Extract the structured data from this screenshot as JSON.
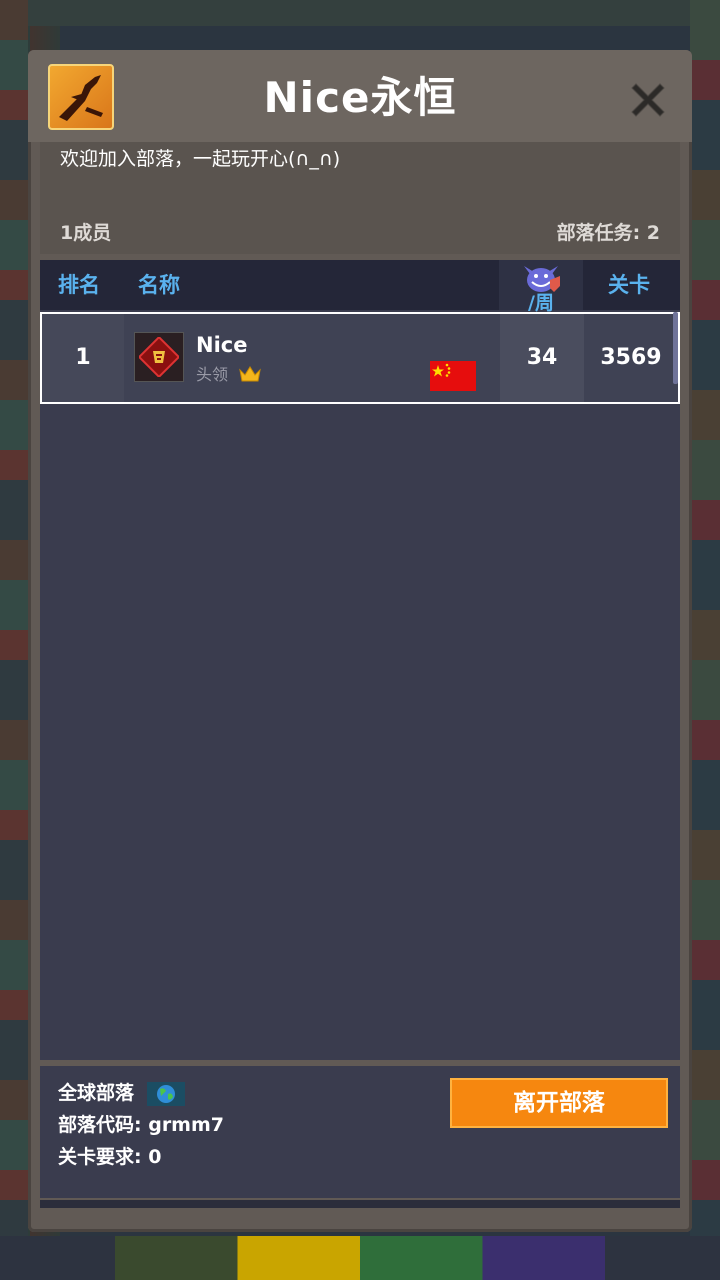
{
  "clan": {
    "name": "Nice永恒",
    "description": "欢迎加入部落，一起玩开心(∩_∩)",
    "member_count_label": "1成员",
    "tasks_label": "部落任务: 2"
  },
  "table": {
    "headers": {
      "rank": "排名",
      "name": "名称",
      "weekly": "/周",
      "level": "关卡"
    },
    "rows": [
      {
        "rank": "1",
        "name": "Nice",
        "role": "头领",
        "weekly": "34",
        "level": "3569",
        "flag": "china-flag-icon"
      }
    ]
  },
  "footer": {
    "global_clan_label": "全球部落",
    "clan_code_label": "部落代码: grmm7",
    "level_requirement_label": "关卡要求: 0",
    "leave_button_label": "离开部落"
  },
  "colors": {
    "accent_blue": "#5ab2ee",
    "leave_button": "#f6870f",
    "panel": "#615a55",
    "table_bg": "#3a3c4e"
  }
}
